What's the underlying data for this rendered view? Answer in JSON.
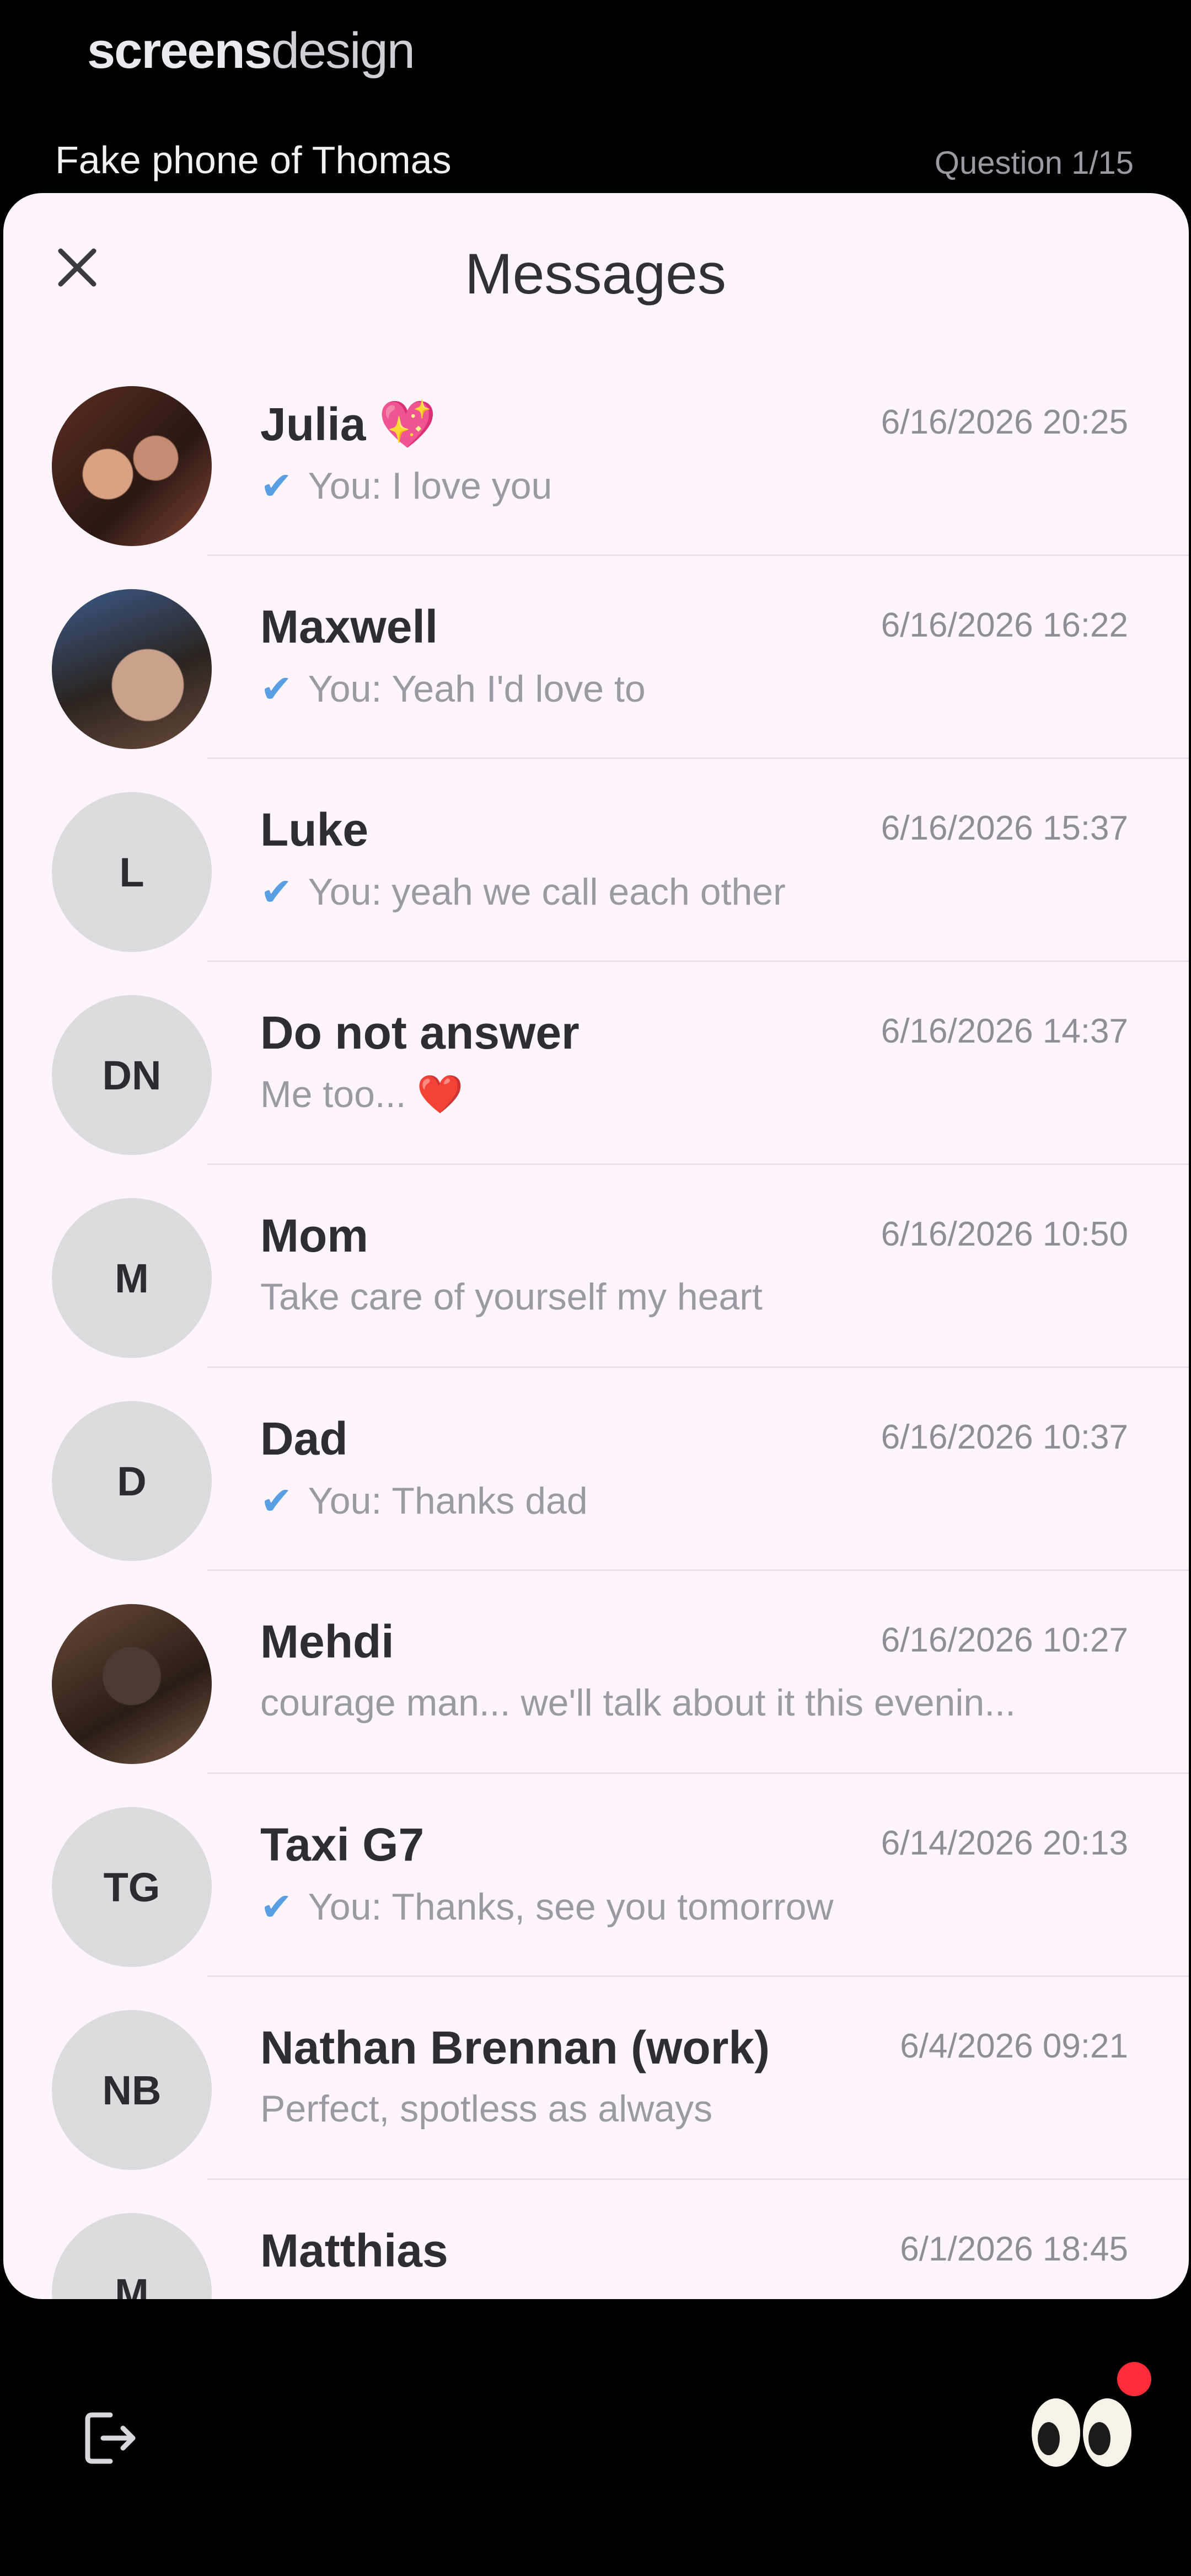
{
  "header": {
    "brand_bold": "screens",
    "brand_light": "design",
    "subtitle": "Fake phone of Thomas",
    "question": "Question 1/15"
  },
  "sheet": {
    "title": "Messages",
    "close_icon": "close-icon"
  },
  "conversations": [
    {
      "name": "Julia 💖",
      "time": "6/16/2026 20:25",
      "sent": true,
      "prefix": "You:",
      "text": "I love you",
      "avatar": "photo"
    },
    {
      "name": "Maxwell",
      "time": "6/16/2026 16:22",
      "sent": true,
      "prefix": "You:",
      "text": "Yeah I'd love to",
      "avatar": "photo"
    },
    {
      "name": "Luke",
      "time": "6/16/2026 15:37",
      "sent": true,
      "prefix": "You:",
      "text": "yeah we call each other",
      "avatar": "L"
    },
    {
      "name": "Do not answer",
      "time": "6/16/2026 14:37",
      "sent": false,
      "prefix": "",
      "text": "Me too... ❤️",
      "avatar": "DN"
    },
    {
      "name": "Mom",
      "time": "6/16/2026 10:50",
      "sent": false,
      "prefix": "",
      "text": "Take care of yourself my heart",
      "avatar": "M"
    },
    {
      "name": "Dad",
      "time": "6/16/2026 10:37",
      "sent": true,
      "prefix": "You:",
      "text": "Thanks dad",
      "avatar": "D"
    },
    {
      "name": "Mehdi",
      "time": "6/16/2026 10:27",
      "sent": false,
      "prefix": "",
      "text": "courage man... we'll talk about it this evenin...",
      "avatar": "photo"
    },
    {
      "name": "Taxi G7",
      "time": "6/14/2026 20:13",
      "sent": true,
      "prefix": "You:",
      "text": "Thanks, see you tomorrow",
      "avatar": "TG"
    },
    {
      "name": "Nathan Brennan (work)",
      "time": "6/4/2026 09:21",
      "sent": false,
      "prefix": "",
      "text": "Perfect, spotless as always",
      "avatar": "NB"
    },
    {
      "name": "Matthias",
      "time": "6/1/2026 18:45",
      "sent": false,
      "prefix": "",
      "text": "",
      "avatar": "M"
    }
  ],
  "footer": {
    "logout_icon": "logout-icon",
    "eyes_icon": "eyes-icon"
  },
  "colors": {
    "sheet_bg": "#fdf5fb",
    "check": "#5a9fe2",
    "badge": "#ff2d3a"
  }
}
